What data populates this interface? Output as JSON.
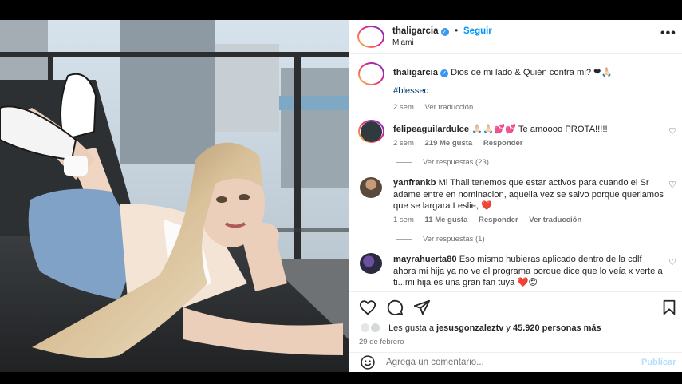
{
  "post": {
    "author": "thaligarcia",
    "follow_label": "Seguir",
    "location": "Miami",
    "more_label": "•••",
    "dot": "•"
  },
  "caption": {
    "username": "thaligarcia",
    "text": "Dios de mi lado & Quién contra mi? ❤🙏🏻",
    "hashtag": "#blessed",
    "time": "2 sem",
    "translate": "Ver traducción"
  },
  "comments": [
    {
      "username": "felipeaguilardulce",
      "text": "🙏🏻🙏🏻💕💕 Te amoooo PROTA!!!!!",
      "time": "2 sem",
      "likes": "219 Me gusta",
      "reply": "Responder",
      "replies": "Ver respuestas (23)"
    },
    {
      "username": "yanfrankb",
      "text": "Mi Thali tenemos que estar activos para cuando el Sr adame entre en nominacion, aquella vez se salvo porque queriamos que se largara Leslie, ❤️",
      "time": "1 sem",
      "likes": "11 Me gusta",
      "reply": "Responder",
      "translate": "Ver traducción",
      "replies": "Ver respuestas (1)"
    },
    {
      "username": "mayrahuerta80",
      "text": "Eso mismo hubieras aplicado dentro de la cdlf ahora mi hija ya no ve el programa porque dice que lo veía x verte a ti...mi hija es una gran fan tuya ❤️😍"
    }
  ],
  "likes_line": {
    "prefix": "Les gusta a",
    "user": "jesusgonzaleztv",
    "middle": "y",
    "count": "45.920 personas más"
  },
  "date": "29 de febrero",
  "composer": {
    "placeholder": "Agrega un comentario...",
    "publish": "Publicar"
  },
  "icons": {
    "like": "heart-icon",
    "comment": "comment-icon",
    "share": "send-icon",
    "save": "bookmark-icon",
    "emoji": "smiley-icon"
  },
  "colors": {
    "link": "#0095f6",
    "verified": "#3897f0",
    "publish_disabled": "#b2dffc",
    "like_red": "#ed4956"
  }
}
